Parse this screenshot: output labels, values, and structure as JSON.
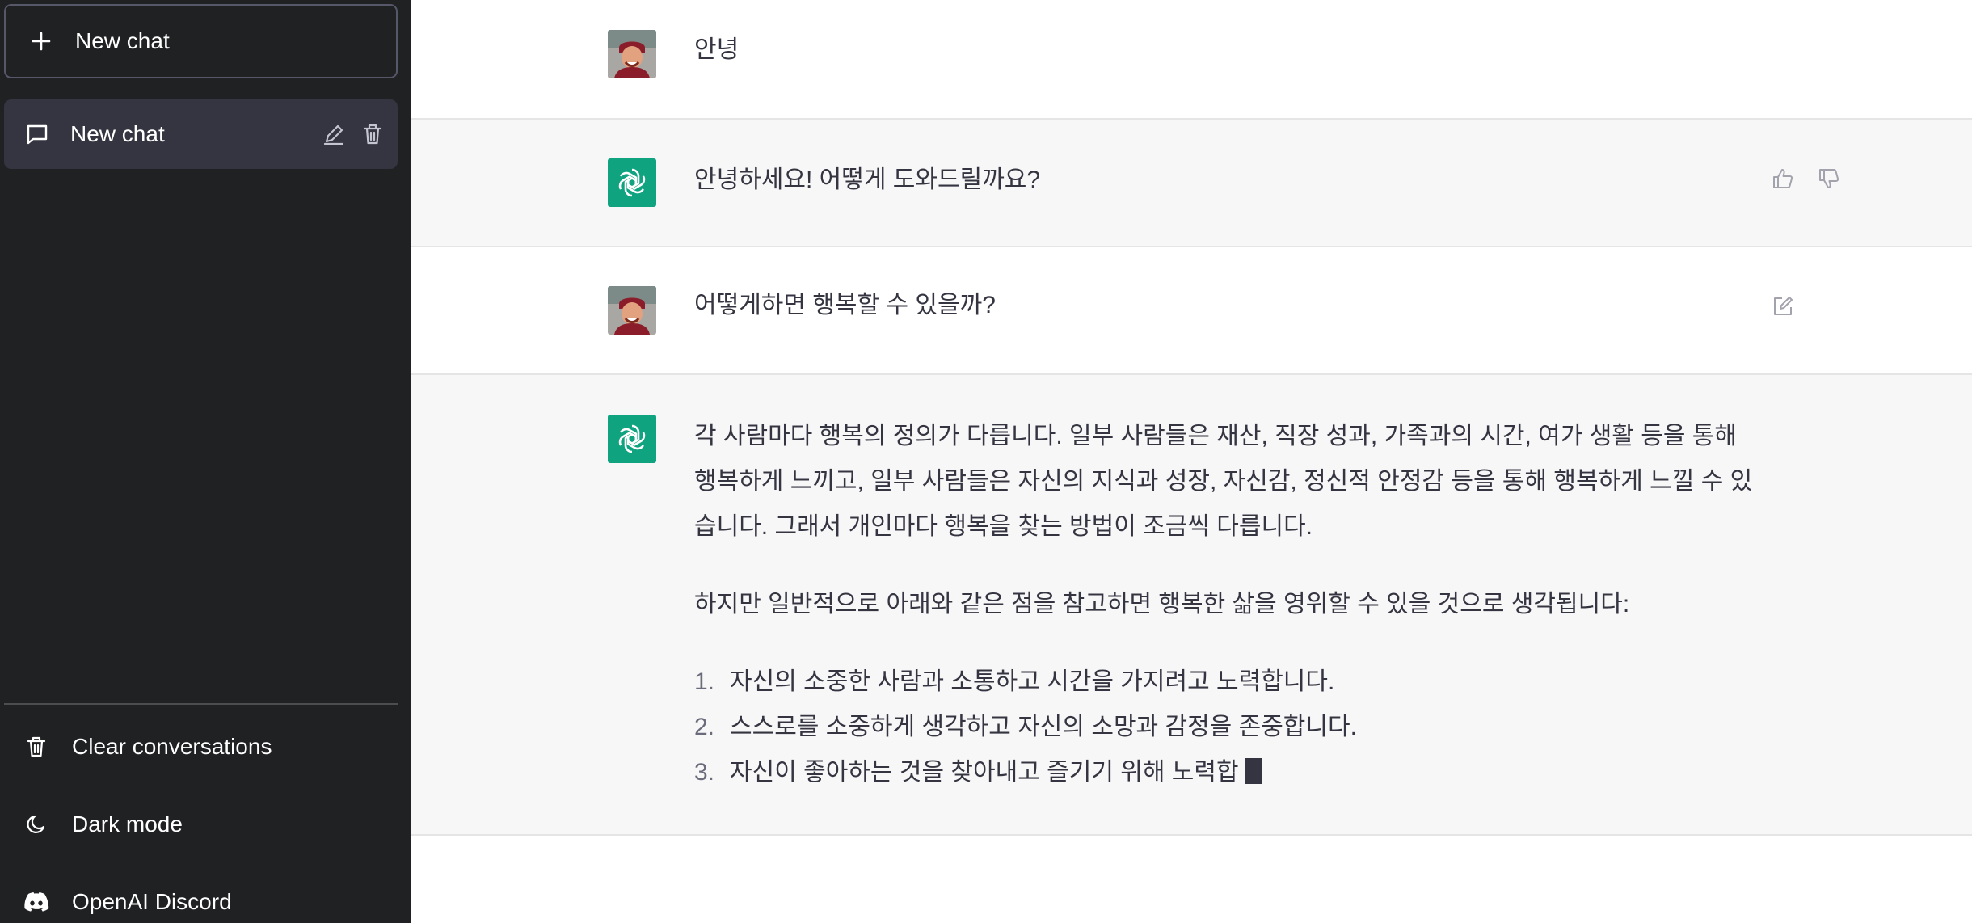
{
  "sidebar": {
    "new_chat_label": "New chat",
    "conversations": [
      {
        "label": "New chat"
      }
    ],
    "footer": {
      "clear": "Clear conversations",
      "dark_mode": "Dark mode",
      "discord": "OpenAI Discord"
    }
  },
  "conversation": {
    "messages": [
      {
        "role": "user",
        "text": "안녕"
      },
      {
        "role": "assistant",
        "text": "안녕하세요! 어떻게 도와드릴까요?"
      },
      {
        "role": "user",
        "text": "어떻게하면 행복할 수 있을까?"
      },
      {
        "role": "assistant",
        "paragraphs": [
          "각 사람마다 행복의 정의가 다릅니다. 일부 사람들은 재산, 직장 성과, 가족과의 시간, 여가 생활 등을 통해 행복하게 느끼고, 일부 사람들은 자신의 지식과 성장, 자신감, 정신적 안정감 등을 통해 행복하게 느낄 수 있습니다. 그래서 개인마다 행복을 찾는 방법이 조금씩 다릅니다.",
          "하지만 일반적으로 아래와 같은 점을 참고하면 행복한 삶을 영위할 수 있을 것으로 생각됩니다:"
        ],
        "list": [
          {
            "num": "1.",
            "text": "자신의 소중한 사람과 소통하고 시간을 가지려고 노력합니다."
          },
          {
            "num": "2.",
            "text": "스스로를 소중하게 생각하고 자신의 소망과 감정을 존중합니다."
          },
          {
            "num": "3.",
            "text": "자신이 좋아하는 것을 찾아내고 즐기기 위해 노력합"
          }
        ]
      }
    ]
  },
  "colors": {
    "sidebar_bg": "#202123",
    "sidebar_active": "#343541",
    "bot_row_bg": "#f7f7f8",
    "assistant_avatar": "#10a37f",
    "text": "#343541"
  },
  "icons": {
    "new_chat": "plus-icon",
    "conversation": "chat-bubble-icon",
    "edit": "pencil-icon",
    "delete": "trash-icon",
    "clear": "trash-icon",
    "dark_mode": "moon-icon",
    "discord": "discord-icon",
    "thumbs_up": "thumbs-up-icon",
    "thumbs_down": "thumbs-down-icon",
    "edit_message": "edit-square-icon",
    "assistant_avatar": "openai-logo-icon"
  }
}
